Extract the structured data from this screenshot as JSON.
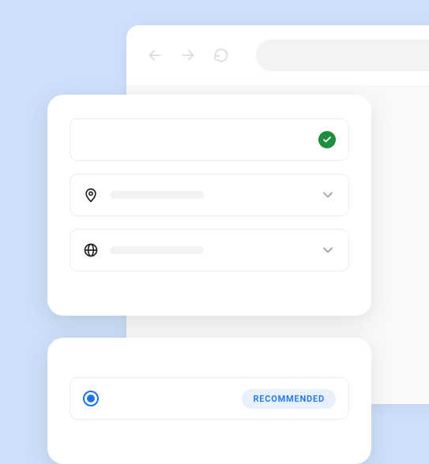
{
  "browser": {
    "back": "",
    "forward": "",
    "reload": ""
  },
  "card1": {
    "verified": true,
    "location_placeholder": "",
    "language_placeholder": ""
  },
  "card2": {
    "recommended_badge": "RECOMMENDED",
    "option_selected": true
  },
  "colors": {
    "accent": "#1a73e8",
    "success": "#1e8e3e",
    "bg": "#cddff9"
  }
}
